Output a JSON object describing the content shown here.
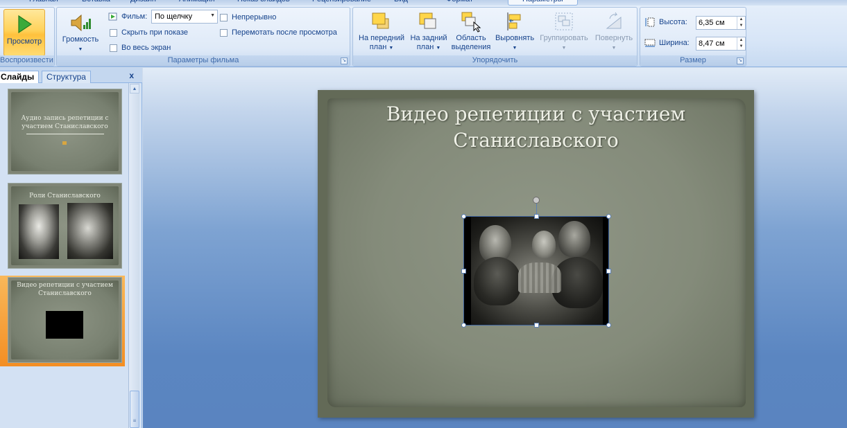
{
  "tabs": [
    {
      "label": "Главная"
    },
    {
      "label": "Вставка"
    },
    {
      "label": "Дизайн"
    },
    {
      "label": "Анимация"
    },
    {
      "label": "Показ слайдов"
    },
    {
      "label": "Рецензирование"
    },
    {
      "label": "Вид"
    },
    {
      "label": "Формат"
    },
    {
      "label": "Параметры"
    }
  ],
  "ribbon": {
    "playback": {
      "preview_label": "Просмотр",
      "group_label": "Воспроизвести"
    },
    "movie_options": {
      "volume_label": "Громкость",
      "movie_label": "Фильм:",
      "movie_select_value": "По щелчку",
      "hide_label": "Скрыть при показе",
      "fullscreen_label": "Во весь экран",
      "loop_label": "Непрерывно",
      "rewind_label": "Перемотать после просмотра",
      "group_label": "Параметры фильма"
    },
    "arrange": {
      "front_line1": "На передний",
      "front_line2": "план",
      "back_line1": "На задний",
      "back_line2": "план",
      "selection_line1": "Область",
      "selection_line2": "выделения",
      "align_label": "Выровнять",
      "group_btn_label": "Группировать",
      "rotate_label": "Повернуть",
      "group_label": "Упорядочить"
    },
    "size": {
      "height_label": "Высота:",
      "height_value": "6,35 см",
      "width_label": "Ширина:",
      "width_value": "8,47 см",
      "group_label": "Размер"
    }
  },
  "panel": {
    "tab_slides": "Слайды",
    "tab_outline": "Структура",
    "close_glyph": "x",
    "slides": [
      {
        "number": "",
        "title": "Аудио запись репетиции с участием Станиславского"
      },
      {
        "number": "",
        "title": "Роли Станиславского"
      },
      {
        "number": "",
        "title": "Видео репетиции с участием Станиславского"
      }
    ]
  },
  "slide": {
    "title": "Видео репетиции с участием Станиславского"
  }
}
